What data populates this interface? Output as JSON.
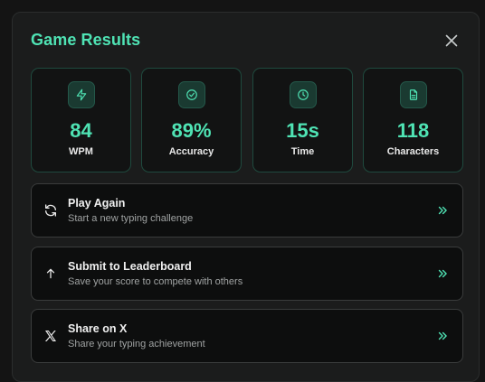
{
  "modal": {
    "title": "Game Results"
  },
  "stats": [
    {
      "icon": "lightning-icon",
      "value": "84",
      "label": "WPM"
    },
    {
      "icon": "check-circle-icon",
      "value": "89%",
      "label": "Accuracy"
    },
    {
      "icon": "clock-icon",
      "value": "15s",
      "label": "Time"
    },
    {
      "icon": "document-icon",
      "value": "118",
      "label": "Characters"
    }
  ],
  "actions": [
    {
      "icon": "refresh-icon",
      "title": "Play Again",
      "description": "Start a new typing challenge"
    },
    {
      "icon": "arrow-up-icon",
      "title": "Submit to Leaderboard",
      "description": "Save your score to compete with others"
    },
    {
      "icon": "x-logo-icon",
      "title": "Share on X",
      "description": "Share your typing achievement"
    }
  ],
  "colors": {
    "accent": "#4fe3b4",
    "modal_bg": "#1b1c1c",
    "card_bg": "#121313",
    "card_border": "#1f4a3e",
    "action_bg": "#0d0e0e",
    "action_border": "#3a3c3c"
  }
}
